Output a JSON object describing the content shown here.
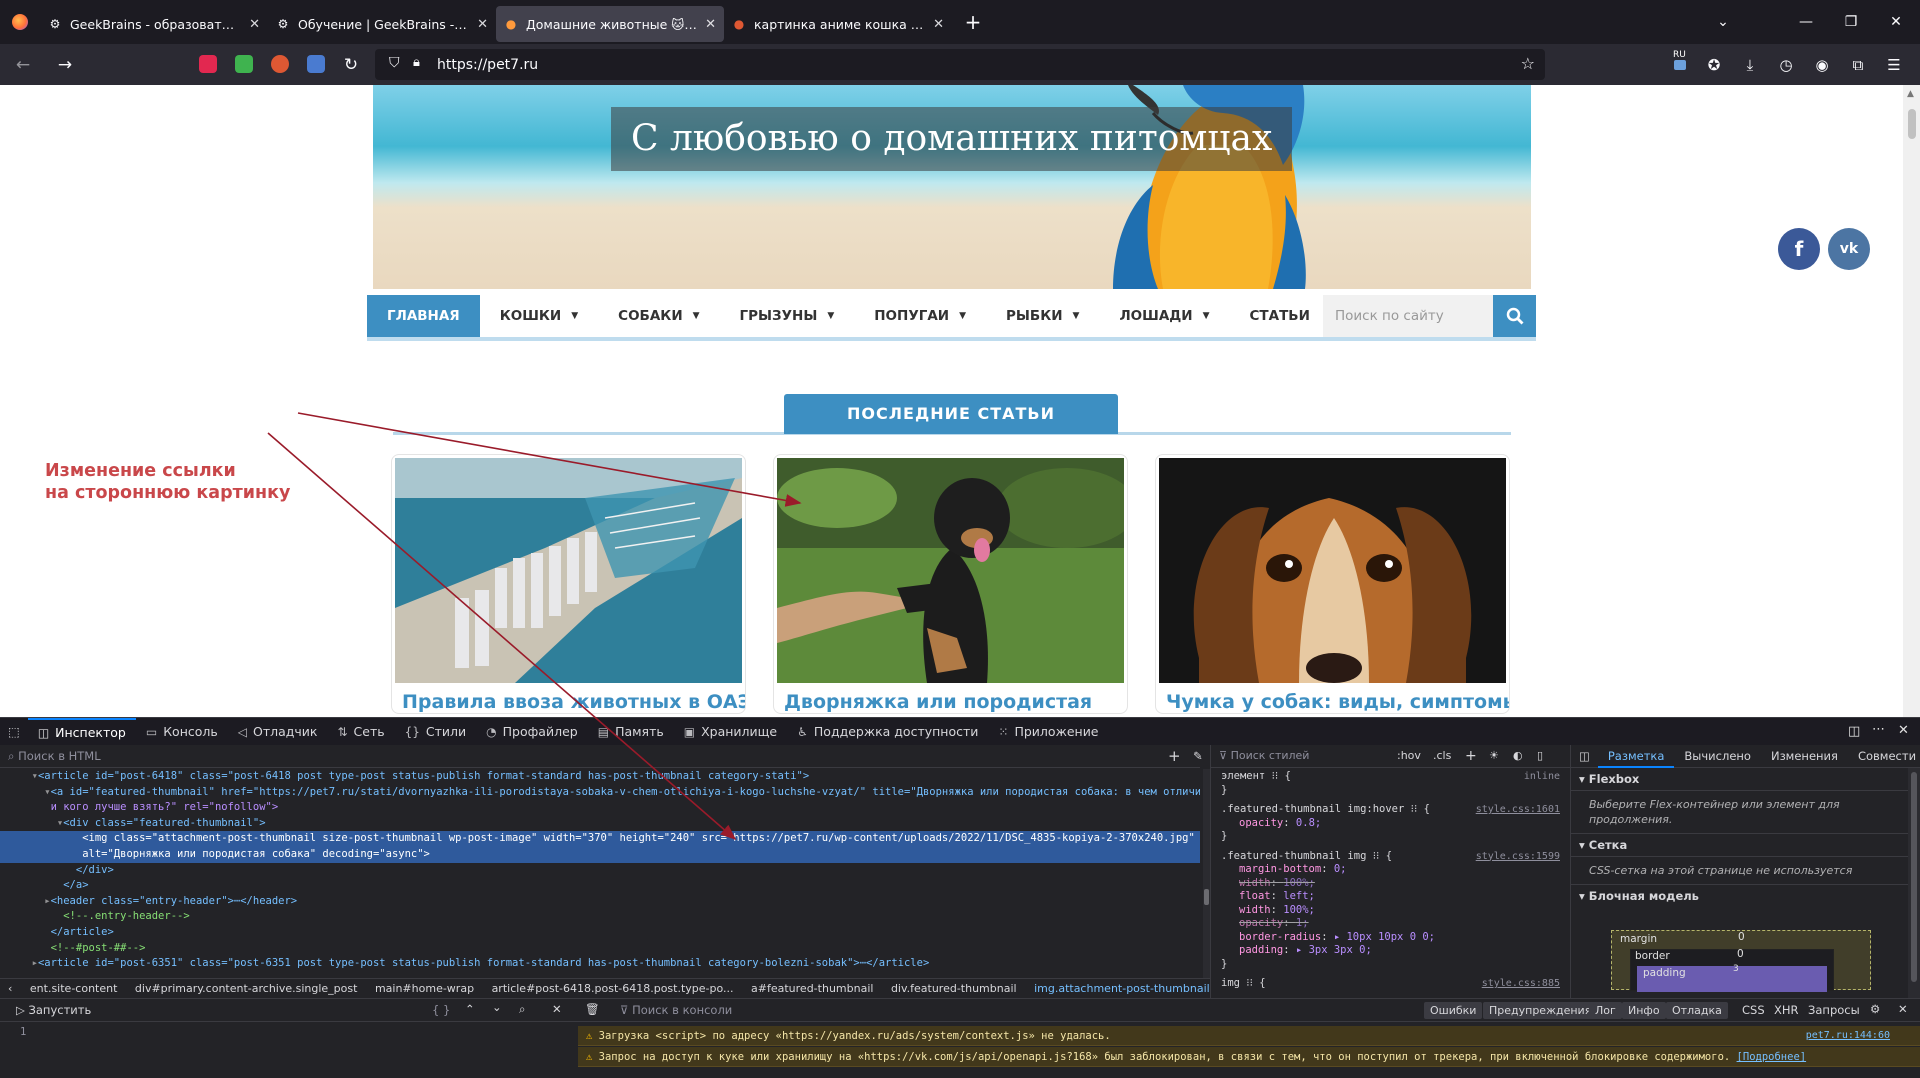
{
  "tabs": [
    {
      "title": "GeekBrains - образовательный",
      "icon": "⚙"
    },
    {
      "title": "Обучение | GeekBrains - обра",
      "icon": "⚙"
    },
    {
      "title": "Домашние животные 🐱 Все",
      "icon": "●"
    },
    {
      "title": "картинка аниме кошка at Duc",
      "icon": "●"
    }
  ],
  "url": "https://pet7.ru",
  "extension_badge": "RU",
  "site": {
    "hero_title": "С любовью о домашних питомцах",
    "social": [
      "f",
      "vk"
    ],
    "menu": [
      "ГЛАВНАЯ",
      "КОШКИ",
      "СОБАКИ",
      "ГРЫЗУНЫ",
      "ПОПУГАИ",
      "РЫБКИ",
      "ЛОШАДИ",
      "СТАТЬИ"
    ],
    "search_placeholder": "Поиск по сайту",
    "section_heading": "ПОСЛЕДНИЕ СТАТЬИ",
    "cards": [
      {
        "title": "Правила ввоза животных в ОАЭ"
      },
      {
        "title": "Дворняжка или породистая"
      },
      {
        "title": "Чумка у собак: виды, симптомы"
      }
    ]
  },
  "annotation": {
    "line1": "Изменение ссылки",
    "line2": "на стороннюю картинку",
    "color": "#c9474a"
  },
  "devtools": {
    "tabs": [
      "Инспектор",
      "Консоль",
      "Отладчик",
      "Сеть",
      "Стили",
      "Профайлер",
      "Память",
      "Хранилище",
      "Поддержка доступности",
      "Приложение"
    ],
    "html_search_placeholder": "Поиск в HTML",
    "styles_filter_placeholder": "Поиск стилей",
    "styles_toggles": [
      ":hov",
      ".cls"
    ],
    "html_lines": [
      {
        "indent": "     ",
        "pre": "▾",
        "text": "<article id=\"post-6418\" class=\"post-6418 post type-post status-publish format-standard has-post-thumbnail category-stati\">"
      },
      {
        "indent": "       ",
        "pre": "▾",
        "text": "<a id=\"featured-thumbnail\" href=\"https://pet7.ru/stati/dvornyazhka-ili-porodistaya-sobaka-v-chem-otlichiya-i-kogo-luchshe-vzyat/\" title=\"Дворняжка или породистая собака: в чем отличия\""
      },
      {
        "indent": "       ",
        "pre": " ",
        "text": "и кого лучше взять?\" rel=\"nofollow\">"
      },
      {
        "indent": "         ",
        "pre": "▾",
        "text": "<div class=\"featured-thumbnail\">"
      },
      {
        "indent": "            ",
        "pre": " ",
        "text": "<img class=\"attachment-post-thumbnail size-post-thumbnail wp-post-image\" width=\"370\" height=\"240\" src=\"https://pet7.ru/wp-content/uploads/2022/11/DSC_4835-kopiya-2-370x240.jpg\""
      },
      {
        "indent": "            ",
        "pre": " ",
        "text": "alt=\"Дворняжка или породистая собака\" decoding=\"async\">"
      },
      {
        "indent": "           ",
        "pre": " ",
        "text": "</div>"
      },
      {
        "indent": "         ",
        "pre": " ",
        "text": "</a>"
      },
      {
        "indent": "       ",
        "pre": "▸",
        "text": "<header class=\"entry-header\">⋯</header>"
      },
      {
        "indent": "         ",
        "pre": " ",
        "text": "<!--.entry-header-->"
      },
      {
        "indent": "       ",
        "pre": " ",
        "text": "</article>"
      },
      {
        "indent": "       ",
        "pre": " ",
        "text": "<!--#post-##-->"
      },
      {
        "indent": "     ",
        "pre": "▸",
        "text": "<article id=\"post-6351\" class=\"post-6351 post type-post status-publish format-standard has-post-thumbnail category-bolezni-sobak\">⋯</article>"
      }
    ],
    "breadcrumbs": [
      "ent.site-content",
      "div#primary.content-archive.single_post",
      "main#home-wrap",
      "article#post-6418.post-6418.post.type-po...",
      "a#featured-thumbnail",
      "div.featured-thumbnail",
      "img.attachment-post-thumbnail.size-post-..."
    ],
    "styles": [
      {
        "sel": "элемент ⁝⁝ {",
        "src": "inline"
      },
      {
        "sel": "}",
        "src": ""
      },
      {
        "sel": ".featured-thumbnail img:hover ⁝⁝ {",
        "src": "style.css:1601"
      },
      {
        "prop": "opacity",
        "val": "0.8;"
      },
      {
        "sel": "}",
        "src": ""
      },
      {
        "sel": ".featured-thumbnail img ⁝⁝ {",
        "src": "style.css:1599"
      },
      {
        "prop": "margin-bottom",
        "val": "0;"
      },
      {
        "prop": "width",
        "val": "100%;",
        "strike": true
      },
      {
        "prop": "float",
        "val": "left;"
      },
      {
        "prop": "width",
        "val": "100%;"
      },
      {
        "prop": "opacity",
        "val": "1;",
        "strike": true
      },
      {
        "prop": "border-radius",
        "val": "▸ 10px 10px 0 0;"
      },
      {
        "prop": "padding",
        "val": "▸ 3px 3px 0;"
      },
      {
        "sel": "}",
        "src": ""
      },
      {
        "sel": "img ⁝⁝ {",
        "src": "style.css:885"
      }
    ],
    "layout_tabs": [
      "Разметка",
      "Вычислено",
      "Изменения",
      "Совмести"
    ],
    "flexbox_title": "Flexbox",
    "flexbox_hint": "Выберите Flex-контейнер или элемент для продолжения.",
    "grid_title": "Сетка",
    "grid_hint": "CSS-сетка на этой странице не используется",
    "boxmodel_title": "Блочная модель",
    "boxmodel": {
      "margin_label": "margin",
      "margin_value": "0",
      "border_label": "border",
      "border_value": "0",
      "padding_label": "padding",
      "padding_value": "3"
    },
    "console_run": "Запустить",
    "console_filter_placeholder": "Поиск в консоли",
    "console_filters": [
      "Ошибки",
      "Предупреждения",
      "Лог",
      "Инфо",
      "Отладка"
    ],
    "console_filters_plain": [
      "CSS",
      "XHR",
      "Запросы"
    ],
    "console_line_no": "1",
    "console_messages": [
      {
        "text": "Загрузка <script> по адресу «https://yandex.ru/ads/system/context.js» не удалась.",
        "src": "pet7.ru:144:60"
      },
      {
        "text": "Запрос на доступ к куке или хранилищу на «https://vk.com/js/api/openapi.js?168» был заблокирован, в связи с тем, что он поступил от трекера, при включенной блокировке содержимого.",
        "link": "[Подробнее]"
      }
    ]
  }
}
